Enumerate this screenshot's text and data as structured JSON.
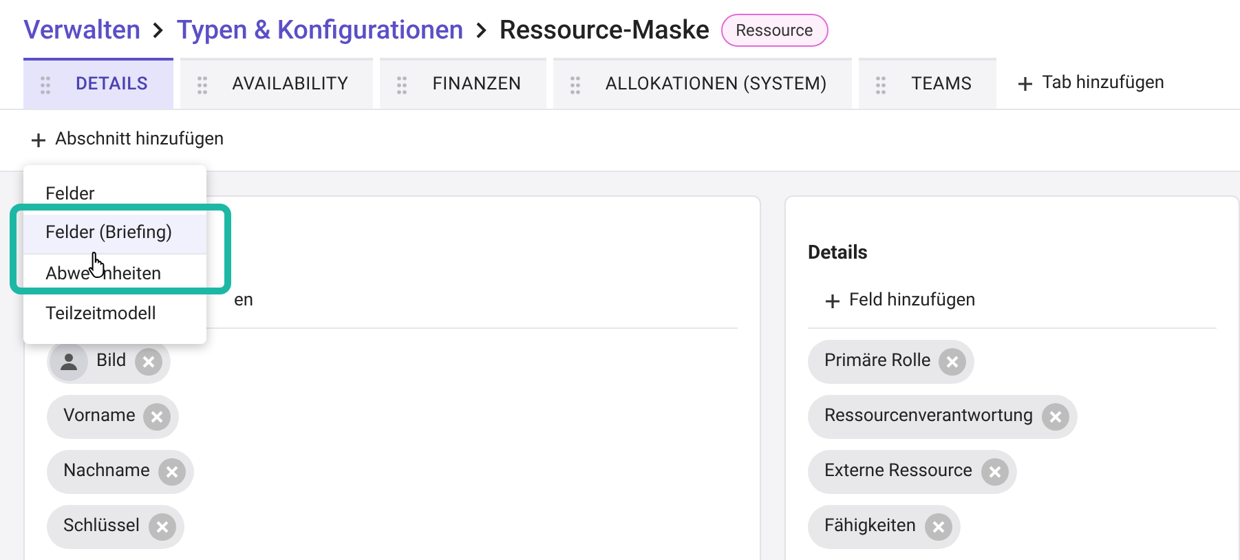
{
  "breadcrumb": [
    {
      "label": "Verwalten",
      "kind": "link"
    },
    {
      "label": "Typen & Konfigurationen",
      "kind": "link"
    },
    {
      "label": "Ressource-Maske",
      "kind": "current"
    }
  ],
  "badge": "Ressource",
  "tabs": [
    {
      "label": "DETAILS",
      "selected": true
    },
    {
      "label": "AVAILABILITY",
      "selected": false
    },
    {
      "label": "FINANZEN",
      "selected": false
    },
    {
      "label": "ALLOKATIONEN (SYSTEM)",
      "selected": false
    },
    {
      "label": "TEAMS",
      "selected": false
    }
  ],
  "add_tab": "Tab hinzufügen",
  "add_section": "Abschnitt hinzufügen",
  "sections": [
    {
      "add_field": "en",
      "fields": [
        {
          "label": "Bild",
          "kind": "avatar"
        },
        {
          "label": "Vorname",
          "kind": "plain"
        },
        {
          "label": "Nachname",
          "kind": "plain"
        },
        {
          "label": "Schlüssel",
          "kind": "plain"
        }
      ]
    },
    {
      "title": "Details",
      "add_field": "Feld hinzufügen",
      "fields": [
        {
          "label": "Primäre Rolle",
          "kind": "plain"
        },
        {
          "label": "Ressourcenverantwortung",
          "kind": "plain"
        },
        {
          "label": "Externe Ressource",
          "kind": "plain"
        },
        {
          "label": "Fähigkeiten",
          "kind": "plain"
        }
      ]
    }
  ],
  "menu": [
    {
      "label": "Felder",
      "selected": false
    },
    {
      "label": "Felder (Briefing)",
      "selected": true
    },
    {
      "label_parts": [
        "Abwe",
        "nheiten"
      ],
      "selected": false
    },
    {
      "label": "Teilzeitmodell",
      "selected": false
    }
  ]
}
